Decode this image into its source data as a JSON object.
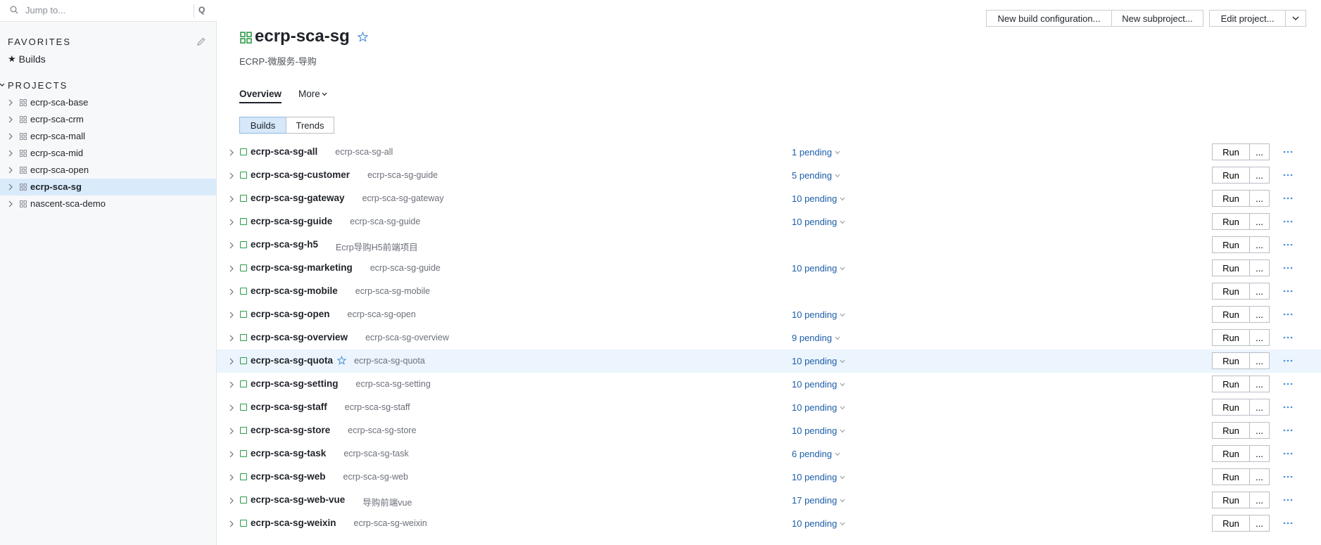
{
  "search": {
    "placeholder": "Jump to...",
    "shortcut": "Q"
  },
  "favorites": {
    "title": "FAVORITES",
    "items": [
      {
        "label": "Builds"
      }
    ]
  },
  "projects": {
    "title": "PROJECTS",
    "items": [
      {
        "label": "ecrp-sca-base"
      },
      {
        "label": "ecrp-sca-crm"
      },
      {
        "label": "ecrp-sca-mall"
      },
      {
        "label": "ecrp-sca-mid"
      },
      {
        "label": "ecrp-sca-open"
      },
      {
        "label": "ecrp-sca-sg"
      },
      {
        "label": "nascent-sca-demo"
      }
    ]
  },
  "header": {
    "title": "ecrp-sca-sg",
    "subtitle": "ECRP-微服务-导购",
    "new_build_config": "New build configuration...",
    "new_subproject": "New subproject...",
    "edit_project": "Edit project..."
  },
  "tabs": {
    "overview": "Overview",
    "more": "More"
  },
  "view_toggle": {
    "builds": "Builds",
    "trends": "Trends"
  },
  "builds": [
    {
      "name": "ecrp-sca-sg-all",
      "desc": "ecrp-sca-sg-all",
      "pending": "1 pending",
      "run": "Run",
      "more": "..."
    },
    {
      "name": "ecrp-sca-sg-customer",
      "desc": "ecrp-sca-sg-guide",
      "pending": "5 pending",
      "run": "Run",
      "more": "..."
    },
    {
      "name": "ecrp-sca-sg-gateway",
      "desc": "ecrp-sca-sg-gateway",
      "pending": "10 pending",
      "run": "Run",
      "more": "..."
    },
    {
      "name": "ecrp-sca-sg-guide",
      "desc": "ecrp-sca-sg-guide",
      "pending": "10 pending",
      "run": "Run",
      "more": "..."
    },
    {
      "name": "ecrp-sca-sg-h5",
      "desc": "Ecrp导购H5前端项目",
      "pending": "",
      "run": "Run",
      "more": "..."
    },
    {
      "name": "ecrp-sca-sg-marketing",
      "desc": "ecrp-sca-sg-guide",
      "pending": "10 pending",
      "run": "Run",
      "more": "..."
    },
    {
      "name": "ecrp-sca-sg-mobile",
      "desc": "ecrp-sca-sg-mobile",
      "pending": "",
      "run": "Run",
      "more": "..."
    },
    {
      "name": "ecrp-sca-sg-open",
      "desc": "ecrp-sca-sg-open",
      "pending": "10 pending",
      "run": "Run",
      "more": "..."
    },
    {
      "name": "ecrp-sca-sg-overview",
      "desc": "ecrp-sca-sg-overview",
      "pending": "9 pending",
      "run": "Run",
      "more": "..."
    },
    {
      "name": "ecrp-sca-sg-quota",
      "desc": "ecrp-sca-sg-quota",
      "pending": "10 pending",
      "run": "Run",
      "more": "..."
    },
    {
      "name": "ecrp-sca-sg-setting",
      "desc": "ecrp-sca-sg-setting",
      "pending": "10 pending",
      "run": "Run",
      "more": "..."
    },
    {
      "name": "ecrp-sca-sg-staff",
      "desc": "ecrp-sca-sg-staff",
      "pending": "10 pending",
      "run": "Run",
      "more": "..."
    },
    {
      "name": "ecrp-sca-sg-store",
      "desc": "ecrp-sca-sg-store",
      "pending": "10 pending",
      "run": "Run",
      "more": "..."
    },
    {
      "name": "ecrp-sca-sg-task",
      "desc": "ecrp-sca-sg-task",
      "pending": "6 pending",
      "run": "Run",
      "more": "..."
    },
    {
      "name": "ecrp-sca-sg-web",
      "desc": "ecrp-sca-sg-web",
      "pending": "10 pending",
      "run": "Run",
      "more": "..."
    },
    {
      "name": "ecrp-sca-sg-web-vue",
      "desc": "导购前端vue",
      "pending": "17 pending",
      "run": "Run",
      "more": "..."
    },
    {
      "name": "ecrp-sca-sg-weixin",
      "desc": "ecrp-sca-sg-weixin",
      "pending": "10 pending",
      "run": "Run",
      "more": "..."
    }
  ],
  "colors": {
    "accent": "#1d5ea8",
    "status_ok": "#2c9b4a",
    "selected_bg": "#d9ebfa",
    "hover_row": "#ecf5fd"
  }
}
